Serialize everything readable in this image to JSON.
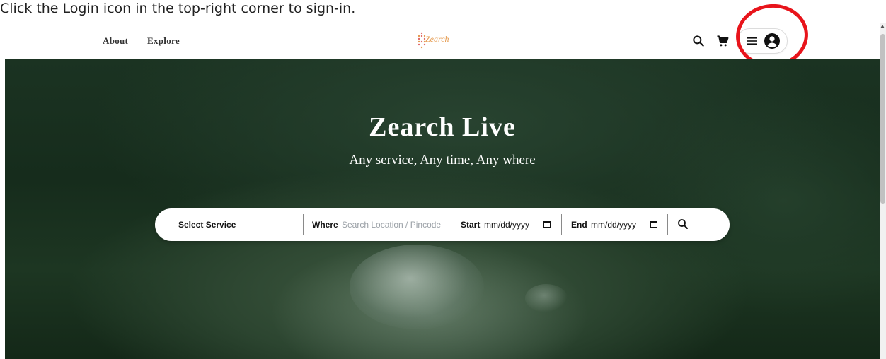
{
  "instruction": "Click the Login icon in the top-right corner to sign-in.",
  "nav": {
    "links": [
      "About",
      "Explore"
    ],
    "logo_text": "Zearch",
    "icons": [
      "search-icon",
      "cart-icon",
      "menu-icon",
      "account-circle-icon"
    ]
  },
  "hero": {
    "title": "Zearch Live",
    "subtitle": "Any service, Any time, Any where"
  },
  "search": {
    "service_label": "Select Service",
    "where_label": "Where",
    "where_placeholder": "Search Location / Pincode",
    "start_label": "Start",
    "start_value": "mm/dd/yyyy",
    "end_label": "End",
    "end_value": "mm/dd/yyyy"
  },
  "colors": {
    "highlight_ring": "#e8141b",
    "logo_accent": "#e59a4e",
    "hero_background": "#1b3322"
  }
}
